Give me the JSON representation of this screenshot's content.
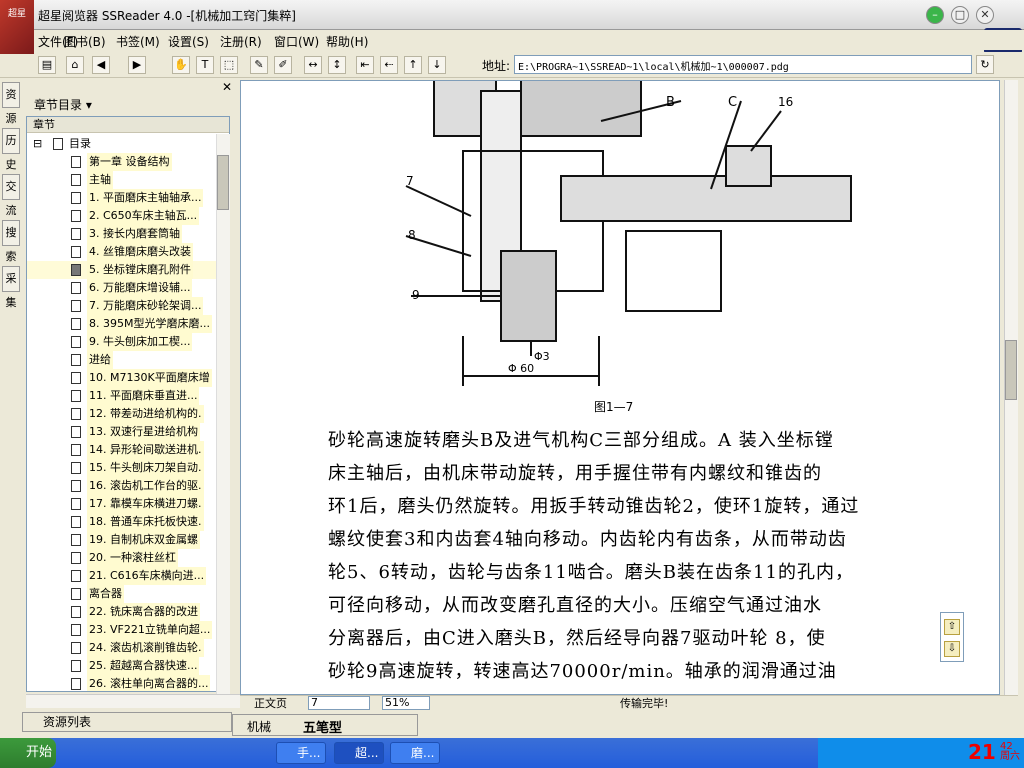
{
  "window": {
    "title": "超星阅览器 SSReader 4.0 -[机械加工窍门集粹]",
    "logo_text": "超星"
  },
  "menu": [
    "文件(F)",
    "图书(B)",
    "书签(M)",
    "设置(S)",
    "注册(R)",
    "窗口(W)",
    "帮助(H)"
  ],
  "toolbar": {
    "address_label": "地址:",
    "address_value": "E:\\PROGRA~1\\SSREAD~1\\local\\机械加~1\\000007.pdg"
  },
  "side_tabs": [
    "资源",
    "历史",
    "交流",
    "搜索",
    "采集"
  ],
  "sidebar": {
    "header": "章节目录 ▾",
    "tree_header": "章节",
    "root": "目录",
    "items": [
      {
        "label": "第一章  设备结构"
      },
      {
        "label": "主轴"
      },
      {
        "label": "1. 平面磨床主轴轴承..."
      },
      {
        "label": "2. C650车床主轴瓦..."
      },
      {
        "label": "3. 接长内磨套筒轴"
      },
      {
        "label": "4. 丝锥磨床磨头改装"
      },
      {
        "label": "5. 坐标镗床磨孔附件",
        "selected": true
      },
      {
        "label": "6. 万能磨床增设辅..."
      },
      {
        "label": "7. 万能磨床砂轮架调..."
      },
      {
        "label": "8. 395M型光学磨床磨..."
      },
      {
        "label": "9. 牛头刨床加工楔..."
      },
      {
        "label": "进给"
      },
      {
        "label": "10. M7130K平面磨床增"
      },
      {
        "label": "11. 平面磨床垂直进..."
      },
      {
        "label": "12. 带差动进给机构的."
      },
      {
        "label": "13. 双速行星进给机构"
      },
      {
        "label": "14. 异形轮间歇送进机."
      },
      {
        "label": "15. 牛头刨床刀架自动."
      },
      {
        "label": "16. 滚齿机工作台的驱."
      },
      {
        "label": "17. 靠模车床横进刀螺."
      },
      {
        "label": "18. 普通车床托板快速."
      },
      {
        "label": "19. 自制机床双金属螺"
      },
      {
        "label": "20. 一种滚柱丝杠"
      },
      {
        "label": "21. C616车床横向进..."
      },
      {
        "label": "离合器"
      },
      {
        "label": "22. 铣床离合器的改进"
      },
      {
        "label": "23. VF221立铣单向超..."
      },
      {
        "label": "24. 滚齿机滚削锥齿轮."
      },
      {
        "label": "25. 超越离合器快速..."
      },
      {
        "label": "26. 滚柱单向离合器的..."
      }
    ]
  },
  "bottom_left_tab": "资源列表",
  "viewer": {
    "figure_labels": [
      "B",
      "C",
      "16",
      "7",
      "8",
      "9",
      "Φ3",
      "Φ 60"
    ],
    "figure_caption": "图1—7",
    "text_lines": [
      "砂轮高速旋转磨头B及进气机构C三部分组成。A 装入坐标镗",
      "床主轴后，由机床带动旋转，用手握住带有内螺纹和锥齿的",
      "环1后，磨头仍然旋转。用扳手转动锥齿轮2，使环1旋转，通过",
      "螺纹使套3和内齿套4轴向移动。内齿轮内有齿条，从而带动齿",
      "轮5、6转动，齿轮与齿条11啮合。磨头B装在齿条11的孔内，",
      "可径向移动，从而改变磨孔直径的大小。压缩空气通过油水",
      "分离器后，由C进入磨头B，然后经导向器7驱动叶轮 8，使",
      "砂轮9高速旋转，转速高达70000r/min。轴承的润滑通过油"
    ]
  },
  "status": {
    "mode": "正文页",
    "page": "7",
    "zoom": "51%",
    "message": "传输完毕!"
  },
  "ime": {
    "label": "五笔型",
    "tab": "机械"
  },
  "taskbar": {
    "start": "开始",
    "tasks": [
      {
        "label": "手..."
      },
      {
        "label": "超...",
        "active": true
      },
      {
        "label": "磨..."
      }
    ],
    "clock": "21",
    "clock_small": "42\n周六"
  }
}
